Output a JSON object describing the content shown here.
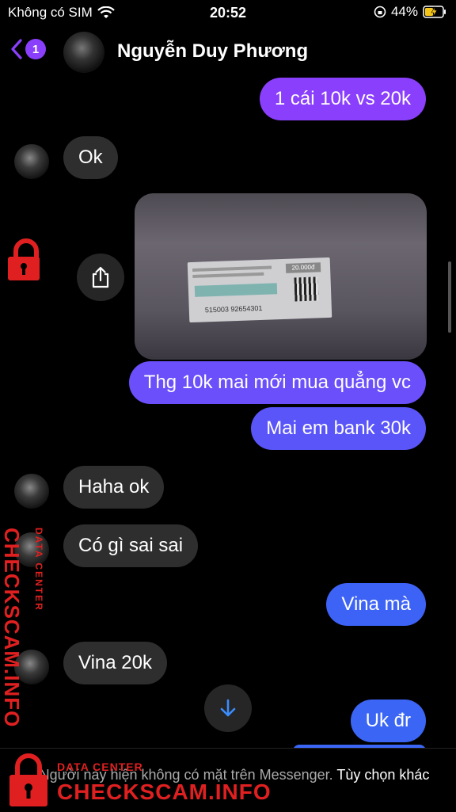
{
  "status_bar": {
    "carrier": "Không có SIM",
    "time": "20:52",
    "battery": "44%"
  },
  "header": {
    "back_count": "1",
    "contact_name": "Nguyễn Duy Phương"
  },
  "messages": [
    {
      "dir": "out",
      "text": "1 cái 10k vs 20k"
    },
    {
      "dir": "in",
      "text": "Ok"
    },
    {
      "dir": "out",
      "type": "image",
      "description": "photo"
    },
    {
      "dir": "out",
      "text": "Thg 10k mai mới mua quẳng vc"
    },
    {
      "dir": "out",
      "text": "Mai em bank 30k"
    },
    {
      "dir": "in",
      "text": "Haha ok"
    },
    {
      "dir": "in",
      "text": "Có gì sai sai"
    },
    {
      "dir": "out",
      "text": "Vina mà"
    },
    {
      "dir": "in",
      "text": "Vina 20k"
    },
    {
      "dir": "out",
      "text": "Uk đr"
    }
  ],
  "ticket": {
    "value": "20.000đ",
    "serial": "515003 92654301"
  },
  "footer": {
    "notice": "Người này hiện không có mặt trên Messenger.",
    "link": "Tùy chọn khác"
  },
  "watermark": {
    "small": "DATA CENTER",
    "big": "CHECKSCAM.INFO"
  },
  "colors": {
    "outgoing_top": "#8a3ffc",
    "outgoing_bottom": "#3b66f5",
    "incoming": "#2e2e2e",
    "watermark": "#e02020"
  },
  "icons": [
    "wifi-icon",
    "battery-icon",
    "back-chevron-icon",
    "share-icon",
    "arrow-down-icon",
    "lock-icon"
  ]
}
